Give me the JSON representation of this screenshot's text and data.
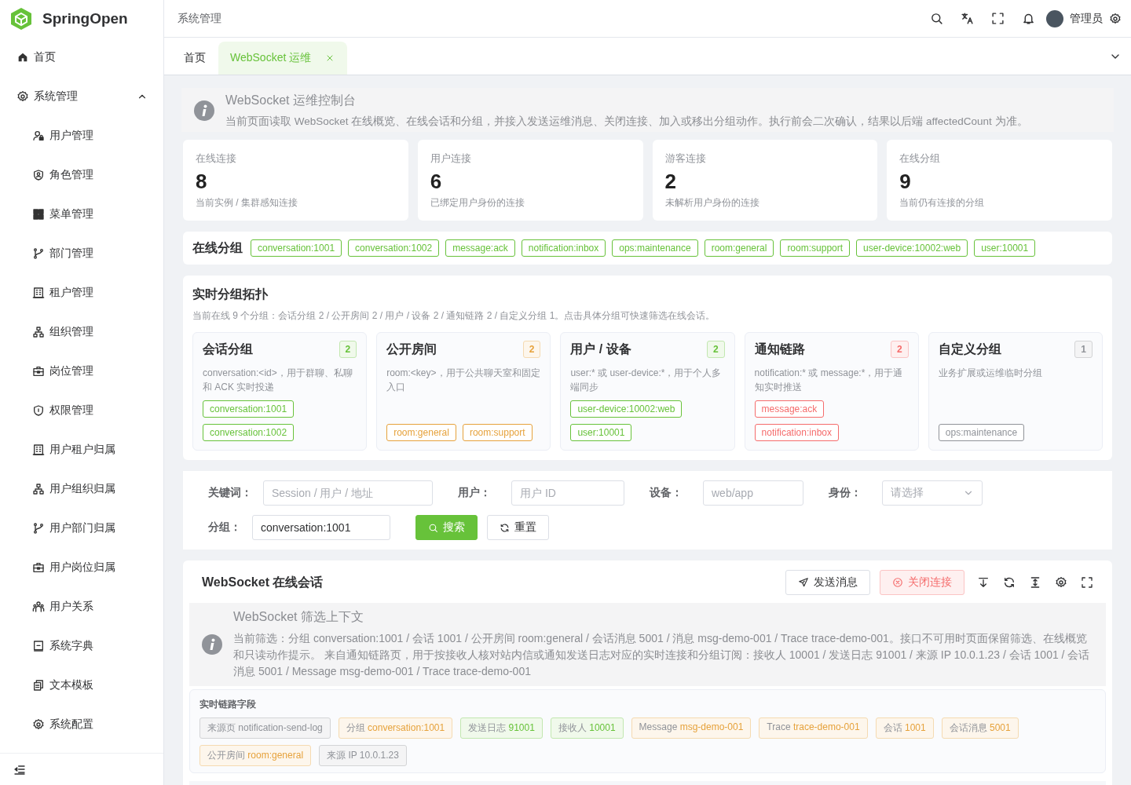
{
  "brand": {
    "name": "SpringOpen"
  },
  "sidebar": {
    "items": [
      {
        "label": "首页"
      },
      {
        "label": "系统管理",
        "expanded": true,
        "children": [
          {
            "label": "用户管理"
          },
          {
            "label": "角色管理"
          },
          {
            "label": "菜单管理"
          },
          {
            "label": "部门管理"
          },
          {
            "label": "租户管理"
          },
          {
            "label": "组织管理"
          },
          {
            "label": "岗位管理"
          },
          {
            "label": "权限管理"
          },
          {
            "label": "用户租户归属"
          },
          {
            "label": "用户组织归属"
          },
          {
            "label": "用户部门归属"
          },
          {
            "label": "用户岗位归属"
          },
          {
            "label": "用户关系"
          },
          {
            "label": "系统字典"
          },
          {
            "label": "文本模板"
          },
          {
            "label": "系统配置"
          }
        ]
      }
    ]
  },
  "header": {
    "breadcrumb": "系统管理",
    "user": "管理员"
  },
  "tabs": [
    {
      "label": "首页",
      "selected": false,
      "closable": false
    },
    {
      "label": "WebSocket 运维",
      "selected": true,
      "closable": true
    }
  ],
  "alert": {
    "title": "WebSocket 运维控制台",
    "text": "当前页面读取 WebSocket 在线概览、在线会话和分组，并接入发送运维消息、关闭连接、加入或移出分组动作。执行前会二次确认，结果以后端 affectedCount 为准。"
  },
  "stats": [
    {
      "label": "在线连接",
      "value": "8",
      "note": "当前实例 / 集群感知连接"
    },
    {
      "label": "用户连接",
      "value": "6",
      "note": "已绑定用户身份的连接"
    },
    {
      "label": "游客连接",
      "value": "2",
      "note": "未解析用户身份的连接"
    },
    {
      "label": "在线分组",
      "value": "9",
      "note": "当前仍有连接的分组"
    }
  ],
  "online_groups": {
    "title": "在线分组",
    "tags": [
      "conversation:1001",
      "conversation:1002",
      "message:ack",
      "notification:inbox",
      "ops:maintenance",
      "room:general",
      "room:support",
      "user-device:10002:web",
      "user:10001"
    ]
  },
  "topology": {
    "title": "实时分组拓扑",
    "subtitle": "当前在线 9 个分组：会话分组 2 / 公开房间 2 / 用户 / 设备 2 / 通知链路 2 / 自定义分组 1。点击具体分组可快速筛选在线会话。",
    "groups": [
      {
        "title": "会话分组",
        "count": "2",
        "color": "#67c23a",
        "desc": "conversation:<id>，用于群聊、私聊和 ACK 实时投递",
        "tags": [
          "conversation:1001",
          "conversation:1002"
        ]
      },
      {
        "title": "公开房间",
        "count": "2",
        "color": "#e6a23c",
        "desc": "room:<key>，用于公共聊天室和固定入口",
        "tags": [
          "room:general",
          "room:support"
        ]
      },
      {
        "title": "用户 / 设备",
        "count": "2",
        "color": "#67c23a",
        "desc": "user:* 或 user-device:*，用于个人多端同步",
        "tags": [
          "user-device:10002:web",
          "user:10001"
        ]
      },
      {
        "title": "通知链路",
        "count": "2",
        "color": "#f56c6c",
        "desc": "notification:* 或 message:*，用于通知实时推送",
        "tags": [
          "message:ack",
          "notification:inbox"
        ]
      },
      {
        "title": "自定义分组",
        "count": "1",
        "color": "#909399",
        "desc": "业务扩展或运维临时分组",
        "tags": [
          "ops:maintenance"
        ]
      }
    ]
  },
  "filter": {
    "fields": [
      {
        "label": "关键词：",
        "kind": "input",
        "placeholder": "Session / 用户 / 地址"
      },
      {
        "label": "用户：",
        "kind": "input",
        "placeholder": "用户 ID"
      },
      {
        "label": "设备：",
        "kind": "input",
        "placeholder": "web/app"
      },
      {
        "label": "身份：",
        "kind": "select",
        "placeholder": "请选择"
      },
      {
        "label": "分组：",
        "kind": "input",
        "value": "conversation:1001"
      }
    ],
    "buttons": [
      {
        "label": "搜索",
        "kind": "primary"
      },
      {
        "label": "重置",
        "kind": "default"
      }
    ]
  },
  "sessions": {
    "title": "WebSocket 在线会话",
    "buttons": [
      {
        "label": "发送消息",
        "kind": "default"
      },
      {
        "label": "关闭连接",
        "kind": "danger"
      }
    ]
  },
  "context": {
    "title": "WebSocket 筛选上下文",
    "text": "当前筛选：分组 conversation:1001 / 会话 1001 / 公开房间 room:general / 会话消息 5001 / 消息 msg-demo-001 / Trace trace-demo-001。接口不可用时页面保留筛选、在线概览和只读动作提示。 来自通知链路页，用于按接收人核对站内信或通知发送日志对应的实时连接和分组订阅：接收人 10001 / 发送日志 91001 / 来源 IP 10.0.1.23 / 会话 1001 / 会话消息 5001 / Message msg-demo-001 / Trace trace-demo-001"
  },
  "link_fields": {
    "title": "实时链路字段",
    "chips": [
      {
        "label": "来源页",
        "value": "notification-send-log",
        "color": "#909399"
      },
      {
        "label": "分组",
        "value": "conversation:1001",
        "color": "#e6a23c"
      },
      {
        "label": "发送日志",
        "value": "91001",
        "color": "#67c23a"
      },
      {
        "label": "接收人",
        "value": "10001",
        "color": "#67c23a"
      },
      {
        "label": "Message",
        "value": "msg-demo-001",
        "color": "#e6a23c"
      },
      {
        "label": "Trace",
        "value": "trace-demo-001",
        "color": "#e6a23c"
      },
      {
        "label": "会话",
        "value": "1001",
        "color": "#e6a23c"
      },
      {
        "label": "会话消息",
        "value": "5001",
        "color": "#e6a23c"
      },
      {
        "label": "公开房间",
        "value": "room:general",
        "color": "#e6a23c"
      },
      {
        "label": "来源 IP",
        "value": "10.0.1.23",
        "color": "#909399"
      }
    ]
  }
}
